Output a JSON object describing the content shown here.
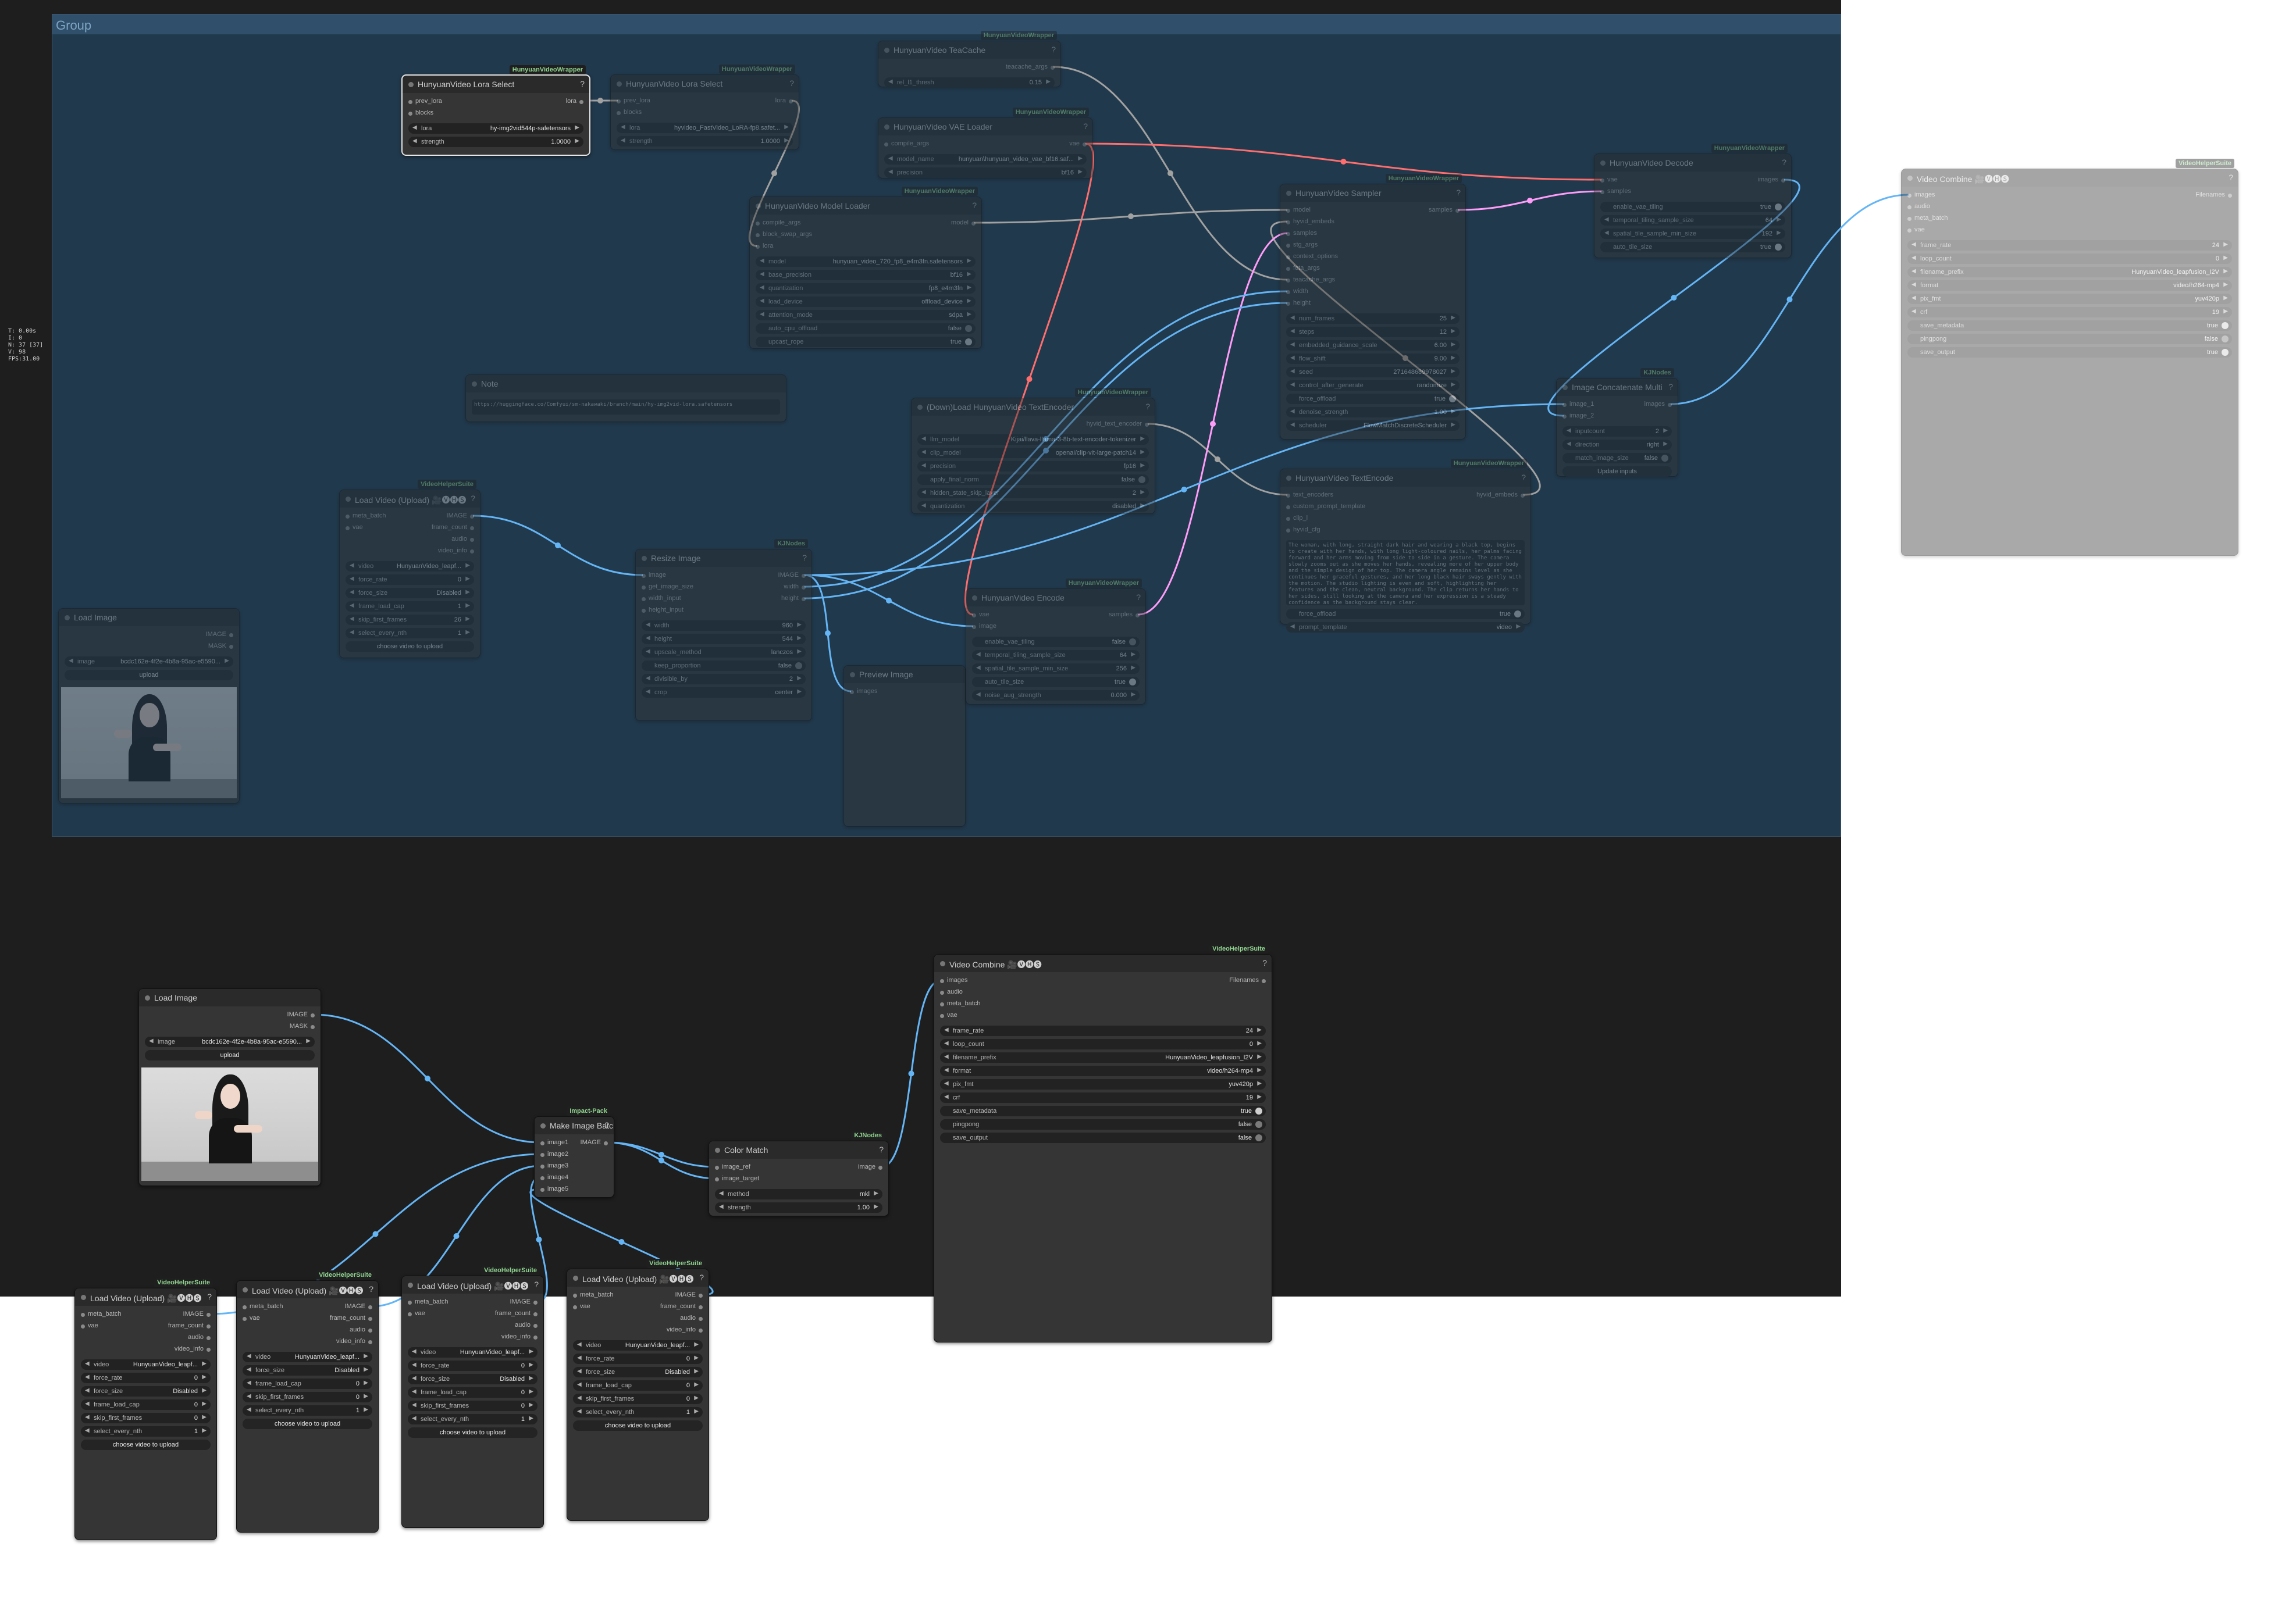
{
  "group": {
    "title": "Group"
  },
  "stats": {
    "lines": "T: 0.00s\nI: 0\nN: 37 [37]\nV: 98\nFPS:31.00"
  },
  "colors": {
    "clip": "#f3cf63",
    "image": "#64b5f6",
    "latent": "#ff9cf9",
    "vae": "#ff6e6e",
    "model": "#b39ddb",
    "generic": "#a1a1a1",
    "group_bg": "#21394c"
  },
  "nodes": {
    "lora1": {
      "badge": "HunyuanVideoWrapper",
      "title": "HunyuanVideo Lora Select",
      "in": [
        "prev_lora",
        "blocks"
      ],
      "out": "lora",
      "w": [
        [
          "lora",
          "hy-img2vid544p-safetensors"
        ],
        [
          "strength",
          "1.0000"
        ]
      ]
    },
    "lora2": {
      "badge": "HunyuanVideoWrapper",
      "title": "HunyuanVideo Lora Select",
      "in": [
        "prev_lora",
        "blocks"
      ],
      "out": "lora",
      "w": [
        [
          "lora",
          "hyvideo_FastVideo_LoRA-fp8.safet..."
        ],
        [
          "strength",
          "1.0000"
        ]
      ]
    },
    "teacache": {
      "badge": "HunyuanVideoWrapper",
      "title": "HunyuanVideo TeaCache",
      "out": "teacache_args",
      "w": [
        [
          "rel_l1_thresh",
          "0.15"
        ]
      ]
    },
    "vae": {
      "badge": "HunyuanVideoWrapper",
      "title": "HunyuanVideo VAE Loader",
      "in": [
        "compile_args"
      ],
      "out": "vae",
      "w": [
        [
          "model_name",
          "hunyuan\\hunyuan_video_vae_bf16.saf..."
        ],
        [
          "precision",
          "bf16"
        ]
      ]
    },
    "model": {
      "badge": "HunyuanVideoWrapper",
      "title": "HunyuanVideo Model Loader",
      "in": [
        "compile_args",
        "block_swap_args",
        "lora"
      ],
      "out": "model",
      "w": [
        [
          "model",
          "hunyuan_video_720_fp8_e4m3fn.safetensors"
        ],
        [
          "base_precision",
          "bf16"
        ],
        [
          "quantization",
          "fp8_e4m3fn"
        ],
        [
          "load_device",
          "offload_device"
        ],
        [
          "attention_mode",
          "sdpa"
        ],
        [
          "auto_cpu_offload",
          "false"
        ],
        [
          "upcast_rope",
          "true"
        ]
      ]
    },
    "sampler": {
      "badge": "HunyuanVideoWrapper",
      "title": "HunyuanVideo Sampler",
      "in": [
        "model",
        "hyvid_embeds",
        "samples",
        "stg_args",
        "context_options",
        "feta_args",
        "teacache_args",
        "width",
        "height"
      ],
      "out": "samples",
      "w": [
        [
          "num_frames",
          "25"
        ],
        [
          "steps",
          "12"
        ],
        [
          "embedded_guidance_scale",
          "6.00"
        ],
        [
          "flow_shift",
          "9.00"
        ],
        [
          "seed",
          "271648689978027"
        ],
        [
          "control_after_generate",
          "randomize"
        ],
        [
          "force_offload",
          "true"
        ],
        [
          "denoise_strength",
          "1.00"
        ],
        [
          "scheduler",
          "FlowMatchDiscreteScheduler"
        ]
      ]
    },
    "decode": {
      "badge": "HunyuanVideoWrapper",
      "title": "HunyuanVideo Decode",
      "in": [
        "vae",
        "samples"
      ],
      "out": "images",
      "w": [
        [
          "enable_vae_tiling",
          "true"
        ],
        [
          "temporal_tiling_sample_size",
          "64"
        ],
        [
          "spatial_tile_sample_min_size",
          "192"
        ],
        [
          "auto_tile_size",
          "true"
        ]
      ]
    },
    "note": {
      "title": "Note",
      "text": "https://huggingface.co/Comfyui/sm-nakawaki/branch/main/hy-img2vid-lora.safetensors"
    },
    "textenc_loader": {
      "badge": "HunyuanVideoWrapper",
      "title": "(Down)Load HunyuanVideo TextEncoder",
      "out": "hyvid_text_encoder",
      "w": [
        [
          "llm_model",
          "Kijai/llava-llama-3-8b-text-encoder-tokenizer"
        ],
        [
          "clip_model",
          "openai/clip-vit-large-patch14"
        ],
        [
          "precision",
          "fp16"
        ],
        [
          "apply_final_norm",
          "false"
        ],
        [
          "hidden_state_skip_layer",
          "2"
        ],
        [
          "quantization",
          "disabled"
        ]
      ]
    },
    "textenc": {
      "badge": "HunyuanVideoWrapper",
      "title": "HunyuanVideo TextEncode",
      "in": [
        "text_encoders",
        "custom_prompt_template",
        "clip_l",
        "hyvid_cfg"
      ],
      "out": "hyvid_embeds",
      "prompt": "The woman, with long, straight dark hair and wearing a black top, begins to create with her hands, with long light-coloured nails, her palms facing forward and her arms moving from side to side in a gesture. The camera slowly zooms out as she moves her hands, revealing more of her upper body and the simple design of her top. The camera angle remains level as she continues her graceful gestures, and her long black hair sways gently with the motion. The studio lighting is even and soft, highlighting her features and the clean, neutral background. The clip returns her hands to her sides, still looking at the camera and her expression is a steady confidence as the background stays clear.",
      "w": [
        [
          "force_offload",
          "true"
        ],
        [
          "prompt_template",
          "video"
        ]
      ]
    },
    "imgconcat": {
      "badge": "KJNodes",
      "title": "Image Concatenate Multi",
      "in": [
        "image_1",
        "image_2"
      ],
      "out": "images",
      "w": [
        [
          "inputcount",
          "2"
        ],
        [
          "direction",
          "right"
        ],
        [
          "match_image_size",
          "false"
        ]
      ],
      "button": "Update inputs"
    },
    "loadvideo_g": {
      "badge": "VideoHelperSuite",
      "title": "Load Video (Upload) 🎥🅥🅗🅢",
      "in": [
        "meta_batch",
        "vae"
      ],
      "out": [
        "IMAGE",
        "frame_count",
        "audio",
        "video_info"
      ],
      "w": [
        [
          "video",
          "HunyuanVideo_leapf..."
        ],
        [
          "force_rate",
          "0"
        ],
        [
          "force_size",
          "Disabled"
        ],
        [
          "frame_load_cap",
          "1"
        ],
        [
          "skip_first_frames",
          "26"
        ],
        [
          "select_every_nth",
          "1"
        ]
      ],
      "button": "choose video to upload"
    },
    "loadimage_g": {
      "title": "Load Image",
      "out": [
        "IMAGE",
        "MASK"
      ],
      "w": [
        [
          "image",
          "bcdc162e-4f2e-4b8a-95ac-e5590..."
        ]
      ],
      "button": "upload"
    },
    "resize": {
      "badge": "KJNodes",
      "title": "Resize Image",
      "in": [
        "image",
        "get_image_size",
        "width_input",
        "height_input"
      ],
      "out": [
        "IMAGE",
        "width",
        "height"
      ],
      "w": [
        [
          "width",
          "960"
        ],
        [
          "height",
          "544"
        ],
        [
          "upscale_method",
          "lanczos"
        ],
        [
          "keep_proportion",
          "false"
        ],
        [
          "divisible_by",
          "2"
        ],
        [
          "crop",
          "center"
        ]
      ]
    },
    "preview": {
      "title": "Preview Image",
      "in": [
        "images"
      ]
    },
    "encode": {
      "badge": "HunyuanVideoWrapper",
      "title": "HunyuanVideo Encode",
      "in": [
        "vae",
        "image"
      ],
      "out": "samples",
      "w": [
        [
          "enable_vae_tiling",
          "false"
        ],
        [
          "temporal_tiling_sample_size",
          "64"
        ],
        [
          "spatial_tile_sample_min_size",
          "256"
        ],
        [
          "auto_tile_size",
          "true"
        ],
        [
          "noise_aug_strength",
          "0.000"
        ]
      ]
    },
    "vc_dim": {
      "badge": "VideoHelperSuite",
      "title": "Video Combine 🎥🅥🅗🅢",
      "in": [
        "images",
        "audio",
        "meta_batch",
        "vae"
      ],
      "out": "Filenames",
      "w": [
        [
          "frame_rate",
          "24"
        ],
        [
          "loop_count",
          "0"
        ],
        [
          "filename_prefix",
          "HunyuanVideo_leapfusion_I2V"
        ],
        [
          "format",
          "video/h264-mp4"
        ],
        [
          "pix_fmt",
          "yuv420p"
        ],
        [
          "crf",
          "19"
        ],
        [
          "save_metadata",
          "true"
        ],
        [
          "pingpong",
          "false"
        ],
        [
          "save_output",
          "true"
        ]
      ]
    },
    "loadimage2": {
      "title": "Load Image",
      "out": [
        "IMAGE",
        "MASK"
      ],
      "w": [
        [
          "image",
          "bcdc162e-4f2e-4b8a-95ac-e5590..."
        ]
      ],
      "button": "upload"
    },
    "makebatch": {
      "badge": "Impact-Pack",
      "title": "Make Image Batch",
      "in": [
        "image1",
        "image2",
        "image3",
        "image4",
        "image5"
      ],
      "out": "IMAGE"
    },
    "colormatch": {
      "badge": "KJNodes",
      "title": "Color Match",
      "in": [
        "image_ref",
        "image_target"
      ],
      "out": "image",
      "w": [
        [
          "method",
          "mkl"
        ],
        [
          "strength",
          "1.00"
        ]
      ]
    },
    "vc": {
      "badge": "VideoHelperSuite",
      "title": "Video Combine 🎥🅥🅗🅢",
      "in": [
        "images",
        "audio",
        "meta_batch",
        "vae"
      ],
      "out": "Filenames",
      "w": [
        [
          "frame_rate",
          "24"
        ],
        [
          "loop_count",
          "0"
        ],
        [
          "filename_prefix",
          "HunyuanVideo_leapfusion_I2V"
        ],
        [
          "format",
          "video/h264-mp4"
        ],
        [
          "pix_fmt",
          "yuv420p"
        ],
        [
          "crf",
          "19"
        ],
        [
          "save_metadata",
          "true"
        ],
        [
          "pingpong",
          "false"
        ],
        [
          "save_output",
          "false"
        ]
      ]
    },
    "lv1": {
      "badge": "VideoHelperSuite",
      "title": "Load Video (Upload) 🎥🅥🅗🅢",
      "in": [
        "meta_batch",
        "vae"
      ],
      "out": [
        "IMAGE",
        "frame_count",
        "audio",
        "video_info"
      ],
      "w": [
        [
          "video",
          "HunyuanVideo_leapf..."
        ],
        [
          "force_rate",
          "0"
        ],
        [
          "force_size",
          "Disabled"
        ],
        [
          "frame_load_cap",
          "0"
        ],
        [
          "skip_first_frames",
          "0"
        ],
        [
          "select_every_nth",
          "1"
        ]
      ],
      "button": "choose video to upload"
    },
    "lv2": {
      "badge": "VideoHelperSuite",
      "title": "Load Video (Upload) 🎥🅥🅗🅢",
      "in": [
        "meta_batch",
        "vae"
      ],
      "out": [
        "IMAGE",
        "frame_count",
        "audio",
        "video_info"
      ],
      "w": [
        [
          "video",
          "HunyuanVideo_leapf..."
        ],
        [
          "force_size",
          "Disabled"
        ],
        [
          "frame_load_cap",
          "0"
        ],
        [
          "skip_first_frames",
          "0"
        ],
        [
          "select_every_nth",
          "1"
        ]
      ],
      "button": "choose video to upload"
    },
    "lv3": {
      "badge": "VideoHelperSuite",
      "title": "Load Video (Upload) 🎥🅥🅗🅢",
      "in": [
        "meta_batch",
        "vae"
      ],
      "out": [
        "IMAGE",
        "frame_count",
        "audio",
        "video_info"
      ],
      "w": [
        [
          "video",
          "HunyuanVideo_leapf..."
        ],
        [
          "force_rate",
          "0"
        ],
        [
          "force_size",
          "Disabled"
        ],
        [
          "frame_load_cap",
          "0"
        ],
        [
          "skip_first_frames",
          "0"
        ],
        [
          "select_every_nth",
          "1"
        ]
      ],
      "button": "choose video to upload"
    },
    "lv4": {
      "badge": "VideoHelperSuite",
      "title": "Load Video (Upload) 🎥🅥🅗🅢",
      "in": [
        "meta_batch",
        "vae"
      ],
      "out": [
        "IMAGE",
        "frame_count",
        "audio",
        "video_info"
      ],
      "w": [
        [
          "video",
          "HunyuanVideo_leapf..."
        ],
        [
          "force_rate",
          "0"
        ],
        [
          "force_size",
          "Disabled"
        ],
        [
          "frame_load_cap",
          "0"
        ],
        [
          "skip_first_frames",
          "0"
        ],
        [
          "select_every_nth",
          "1"
        ]
      ],
      "button": "choose video to upload"
    }
  }
}
